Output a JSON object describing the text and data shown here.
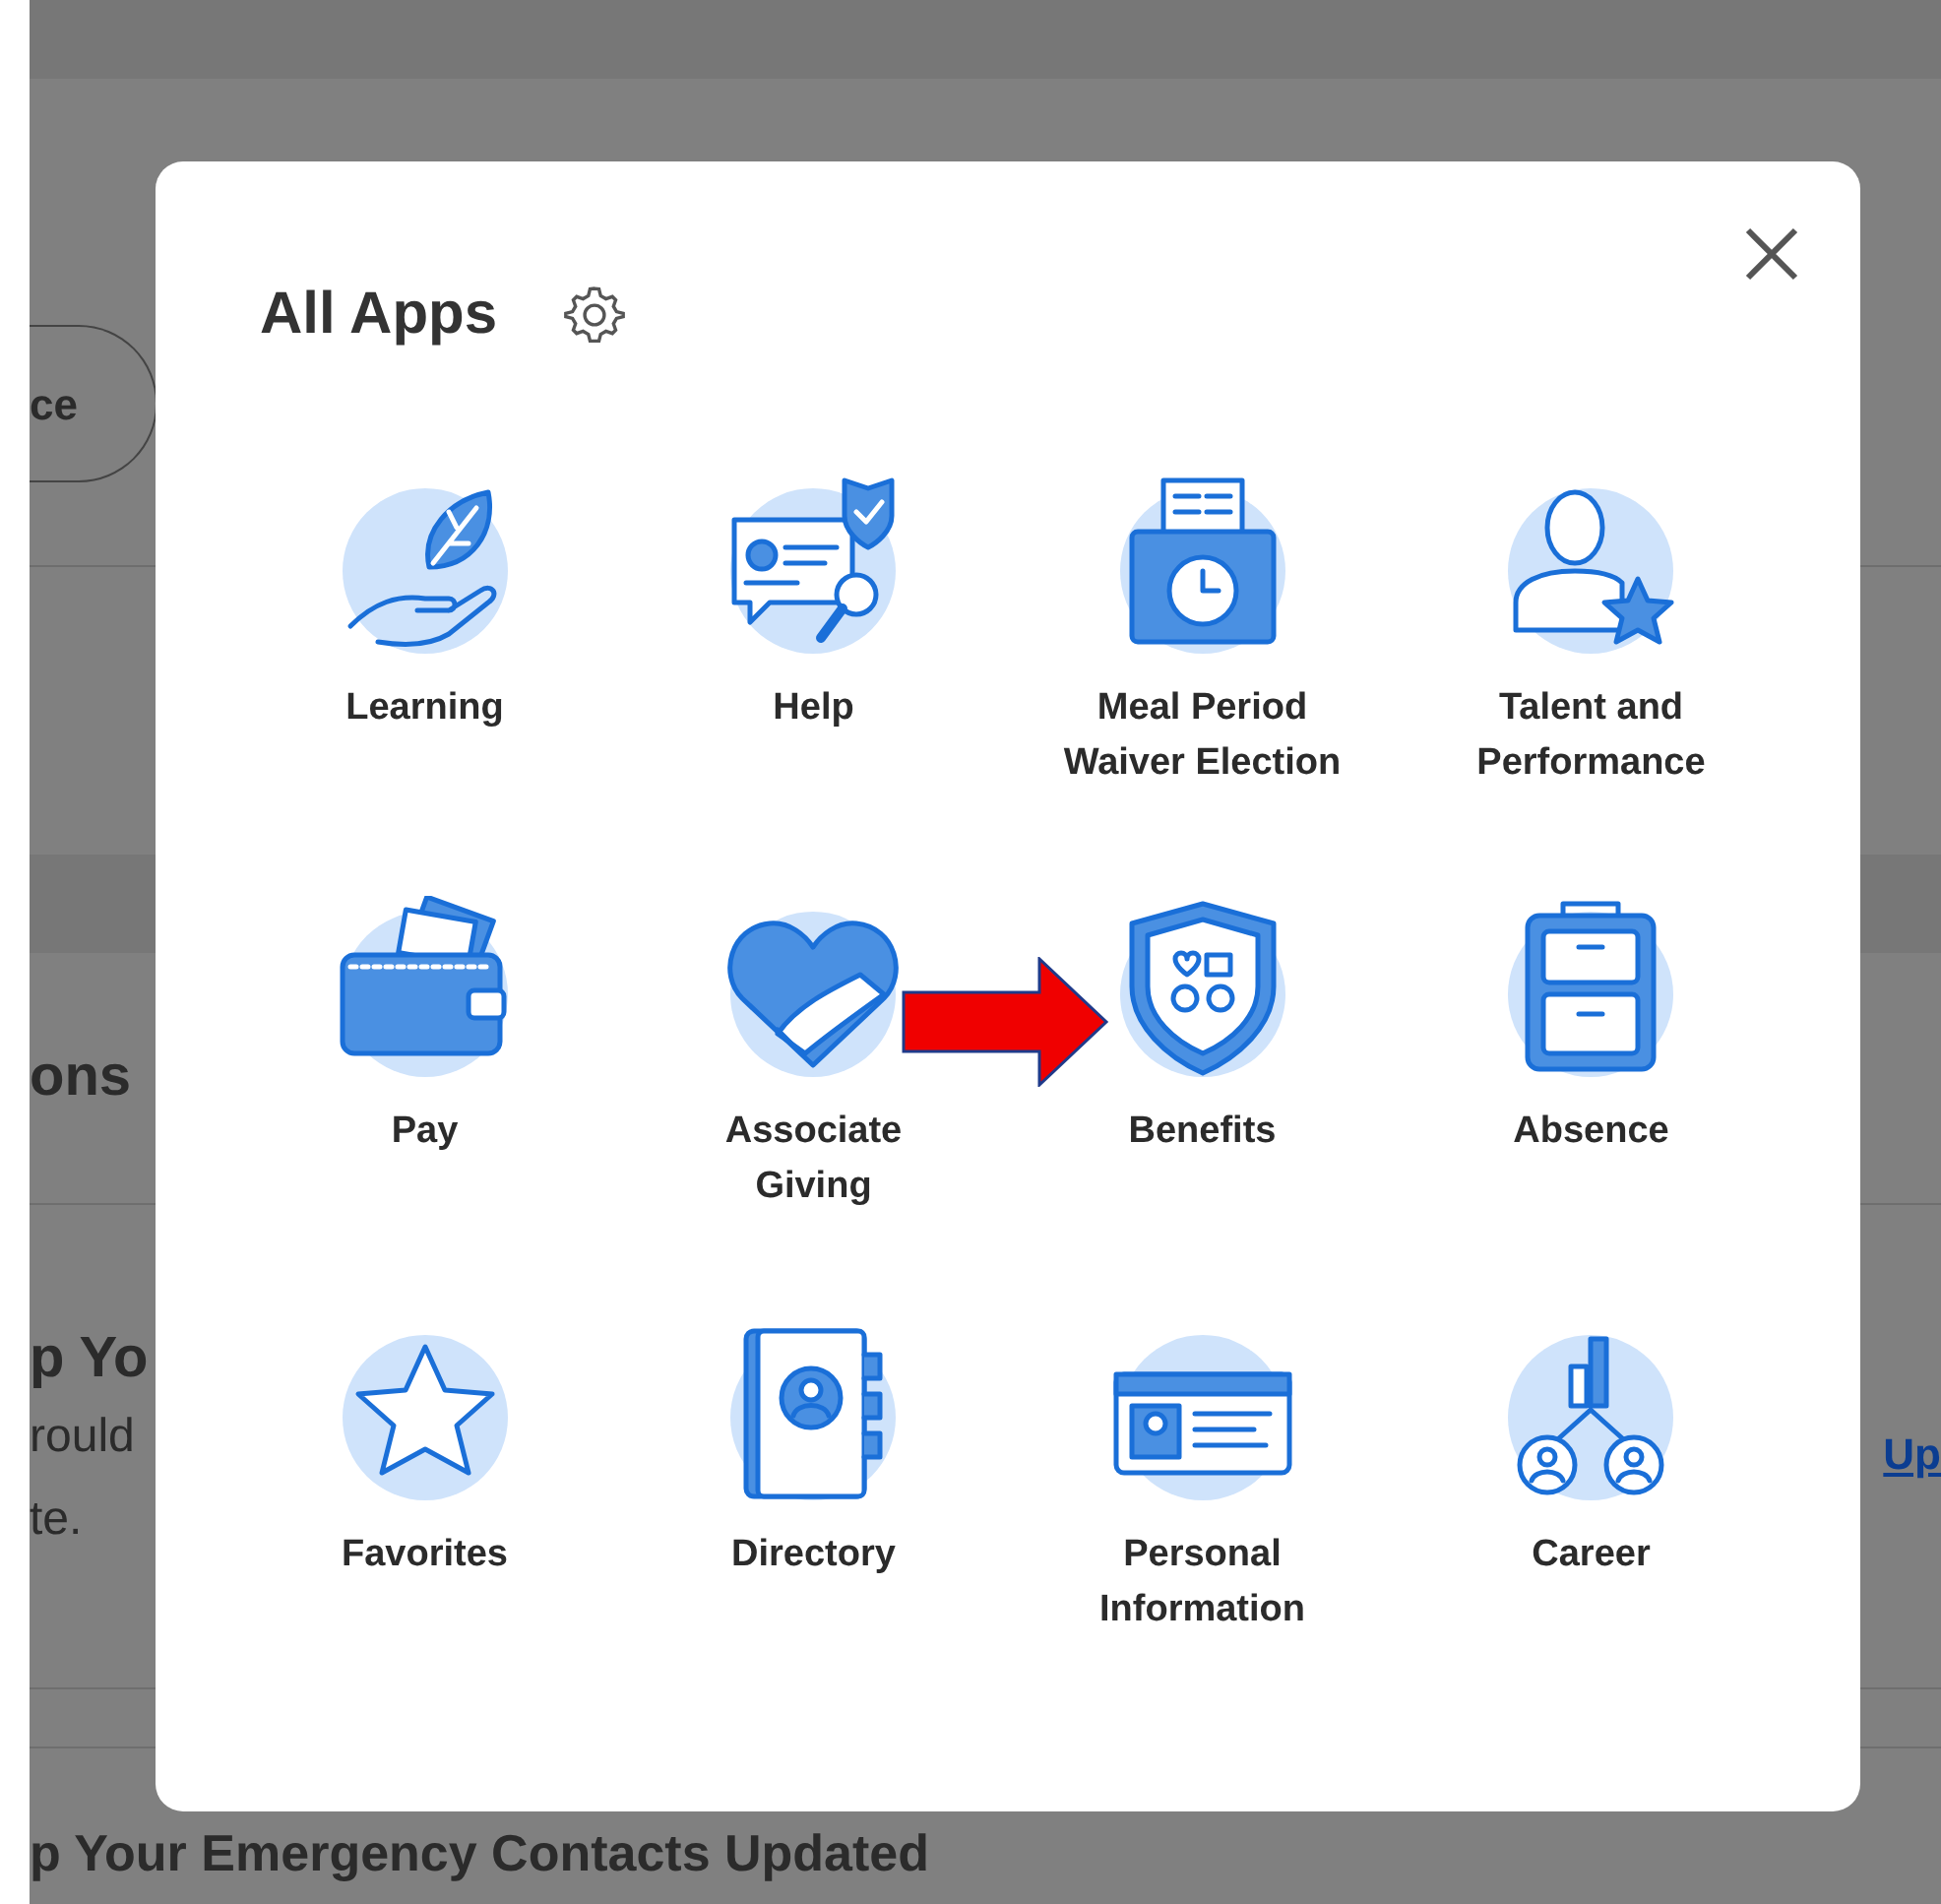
{
  "background": {
    "button": "ce",
    "heading": "ons",
    "card_title": "p Yo",
    "card_text": [
      "rould",
      "te."
    ],
    "link": "Up",
    "bottom_heading": "p Your Emergency Contacts Updated"
  },
  "dialog": {
    "title": "All Apps",
    "apps": [
      {
        "label": "Learning"
      },
      {
        "label": "Help"
      },
      {
        "label": "Meal Period Waiver Election"
      },
      {
        "label": "Talent and Performance"
      },
      {
        "label": "Pay"
      },
      {
        "label": "Associate Giving"
      },
      {
        "label": "Benefits"
      },
      {
        "label": "Absence"
      },
      {
        "label": "Favorites"
      },
      {
        "label": "Directory"
      },
      {
        "label": "Personal Information"
      },
      {
        "label": "Career"
      }
    ]
  }
}
